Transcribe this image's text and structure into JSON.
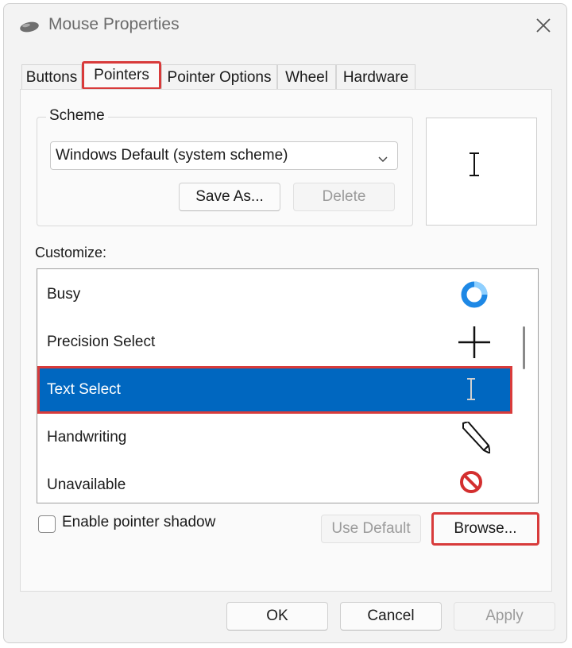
{
  "window": {
    "title": "Mouse Properties"
  },
  "tabs": [
    {
      "label": "Buttons"
    },
    {
      "label": "Pointers"
    },
    {
      "label": "Pointer Options"
    },
    {
      "label": "Wheel"
    },
    {
      "label": "Hardware"
    }
  ],
  "active_tab": "Pointers",
  "scheme": {
    "group_label": "Scheme",
    "selected": "Windows Default (system scheme)",
    "save_as_label": "Save As...",
    "delete_label": "Delete"
  },
  "customize": {
    "label": "Customize:",
    "items": [
      {
        "label": "Busy",
        "icon": "busy-ring-icon"
      },
      {
        "label": "Precision Select",
        "icon": "crosshair-icon"
      },
      {
        "label": "Text Select",
        "icon": "text-beam-icon",
        "selected": true
      },
      {
        "label": "Handwriting",
        "icon": "pen-icon"
      },
      {
        "label": "Unavailable",
        "icon": "unavailable-icon"
      }
    ]
  },
  "shadow": {
    "label": "Enable pointer shadow",
    "checked": false
  },
  "buttons": {
    "use_default": "Use Default",
    "browse": "Browse...",
    "ok": "OK",
    "cancel": "Cancel",
    "apply": "Apply"
  },
  "colors": {
    "selection": "#0067c0",
    "highlight": "#d83b3b",
    "busy_icon": "#1e88e5",
    "unavailable_icon": "#d32f2f"
  }
}
